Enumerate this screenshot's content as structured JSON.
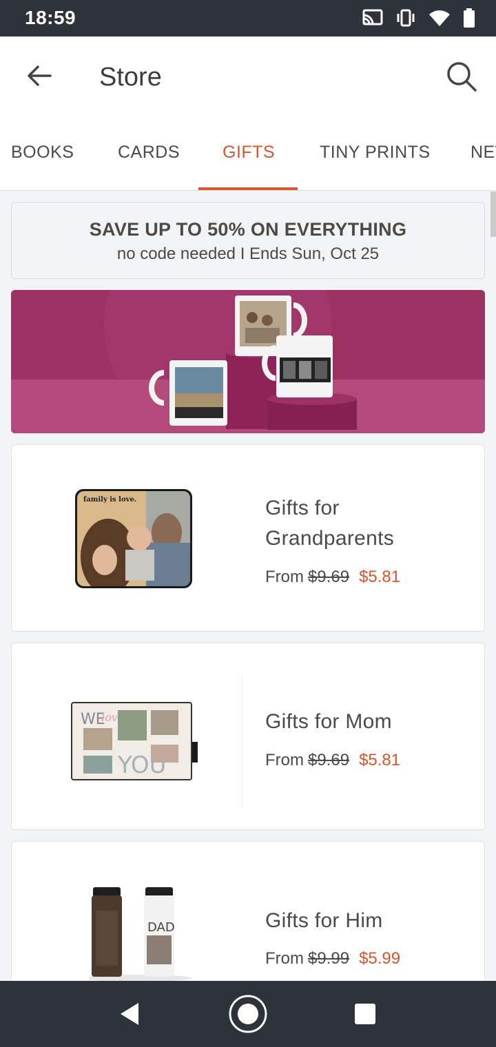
{
  "status": {
    "time": "18:59"
  },
  "appbar": {
    "title": "Store"
  },
  "tabs": [
    {
      "label": "BOOKS",
      "active": false
    },
    {
      "label": "CARDS",
      "active": false
    },
    {
      "label": "GIFTS",
      "active": true
    },
    {
      "label": "TINY PRINTS",
      "active": false
    },
    {
      "label": "NEW",
      "active": false
    }
  ],
  "promo": {
    "headline": "SAVE UP TO 50% ON EVERYTHING",
    "subline": "no code needed I Ends Sun, Oct 25"
  },
  "products": [
    {
      "name_line1": "Gifts for",
      "name_line2": "Grandparents",
      "from": "From",
      "old_price": "$9.69",
      "new_price": "$5.81",
      "photo_caption": "family is love."
    },
    {
      "name_line1": "Gifts for Mom",
      "from": "From",
      "old_price": "$9.69",
      "new_price": "$5.81"
    },
    {
      "name_line1": "Gifts for Him",
      "from": "From",
      "old_price": "$9.99",
      "new_price": "$5.99"
    }
  ],
  "colors": {
    "accent": "#d9552d",
    "banner": "#9b2f63",
    "bars": "#2e323a"
  },
  "icons": [
    "cast-icon",
    "vibrate-icon",
    "wifi-icon",
    "battery-icon",
    "back-arrow-icon",
    "search-icon",
    "nav-back-icon",
    "nav-home-icon",
    "nav-recents-icon"
  ]
}
